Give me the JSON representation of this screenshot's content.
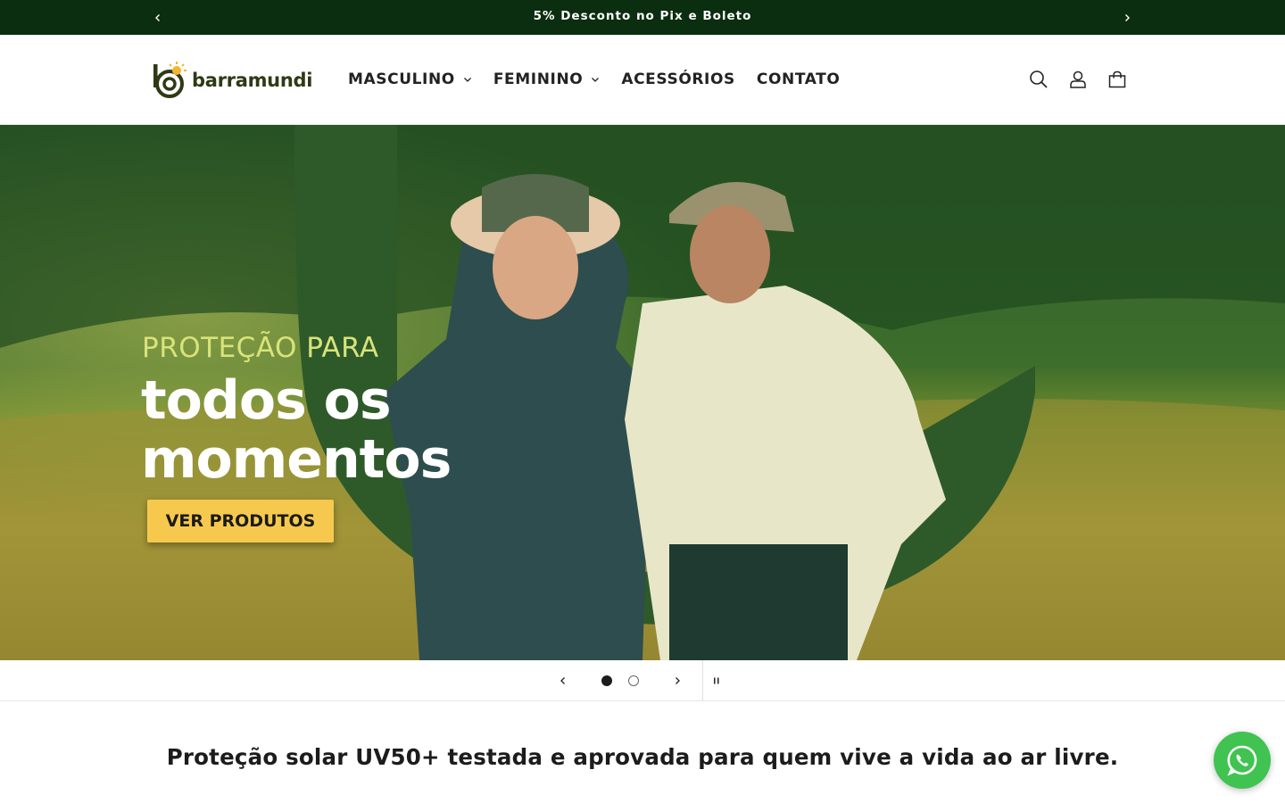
{
  "announcement": {
    "text": "5% Desconto no Pix e Boleto",
    "prev_icon": "chevron-left-icon",
    "next_icon": "chevron-right-icon"
  },
  "header": {
    "logo_text": "barramundi",
    "nav": [
      {
        "label": "MASCULINO",
        "has_dropdown": true
      },
      {
        "label": "FEMININO",
        "has_dropdown": true
      },
      {
        "label": "ACESSÓRIOS",
        "has_dropdown": false
      },
      {
        "label": "CONTATO",
        "has_dropdown": false
      }
    ],
    "icons": [
      "search-icon",
      "account-icon",
      "cart-icon"
    ]
  },
  "hero": {
    "kicker": "PROTEÇÃO PARA",
    "headline_line1": "todos os",
    "headline_line2": "momentos",
    "cta_label": "VER PRODUTOS"
  },
  "slider": {
    "slide_count": 2,
    "active_slide": 1
  },
  "tagline": "Proteção solar UV50+ testada e aprovada para quem vive a vida ao ar livre.",
  "colors": {
    "announcement_bg": "#0b2d10",
    "brand_green": "#2d3a14",
    "accent_yellow": "#f6c94e",
    "whatsapp_green": "#40c351"
  }
}
